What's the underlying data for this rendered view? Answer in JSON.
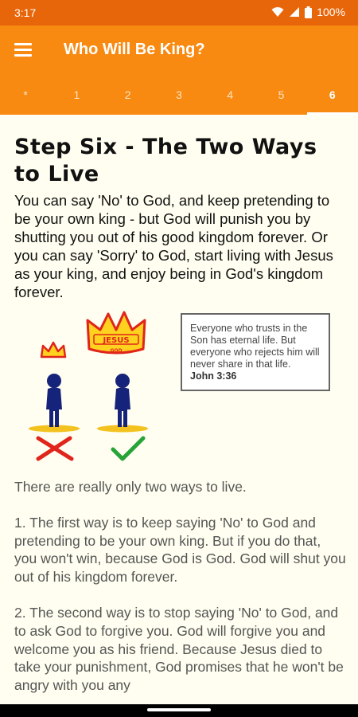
{
  "status": {
    "time": "3:17",
    "battery": "100%"
  },
  "appbar": {
    "title": "Who Will Be King?"
  },
  "tabs": [
    {
      "label": "*"
    },
    {
      "label": "1"
    },
    {
      "label": "2"
    },
    {
      "label": "3"
    },
    {
      "label": "4"
    },
    {
      "label": "5"
    },
    {
      "label": "6"
    }
  ],
  "active_tab": "6",
  "content": {
    "heading": "Step Six - The Two Ways to Live",
    "intro": "You can say 'No' to God, and keep pretending to be your own king - but God will punish you by shutting you out of his good kingdom forever. Or you can say 'Sorry' to God, start living with Jesus as your king, and enjoy being in God's kingdom forever.",
    "crown_text_top": "JESUS",
    "crown_text_bottom": "GOD",
    "verse": {
      "text": "Everyone who trusts in the Son has eternal life. But everyone who rejects him will never share in that life.",
      "ref": "John 3:36"
    },
    "paragraphs": [
      "There are really only two ways to live.",
      "1. The first way is to keep saying 'No' to God and pretending to be your own king. But if you do that, you won't win, because God is God. God will shut you out of his kingdom forever.",
      "2. The second way is to stop saying 'No' to God, and to ask God to forgive you. God will forgive you and welcome you as his friend. Because Jesus died to take your punishment, God promises that he won't be angry with you any"
    ]
  },
  "colors": {
    "status_bar": "#e8660a",
    "app_bar": "#f88a12",
    "page_bg": "#fffef0"
  }
}
